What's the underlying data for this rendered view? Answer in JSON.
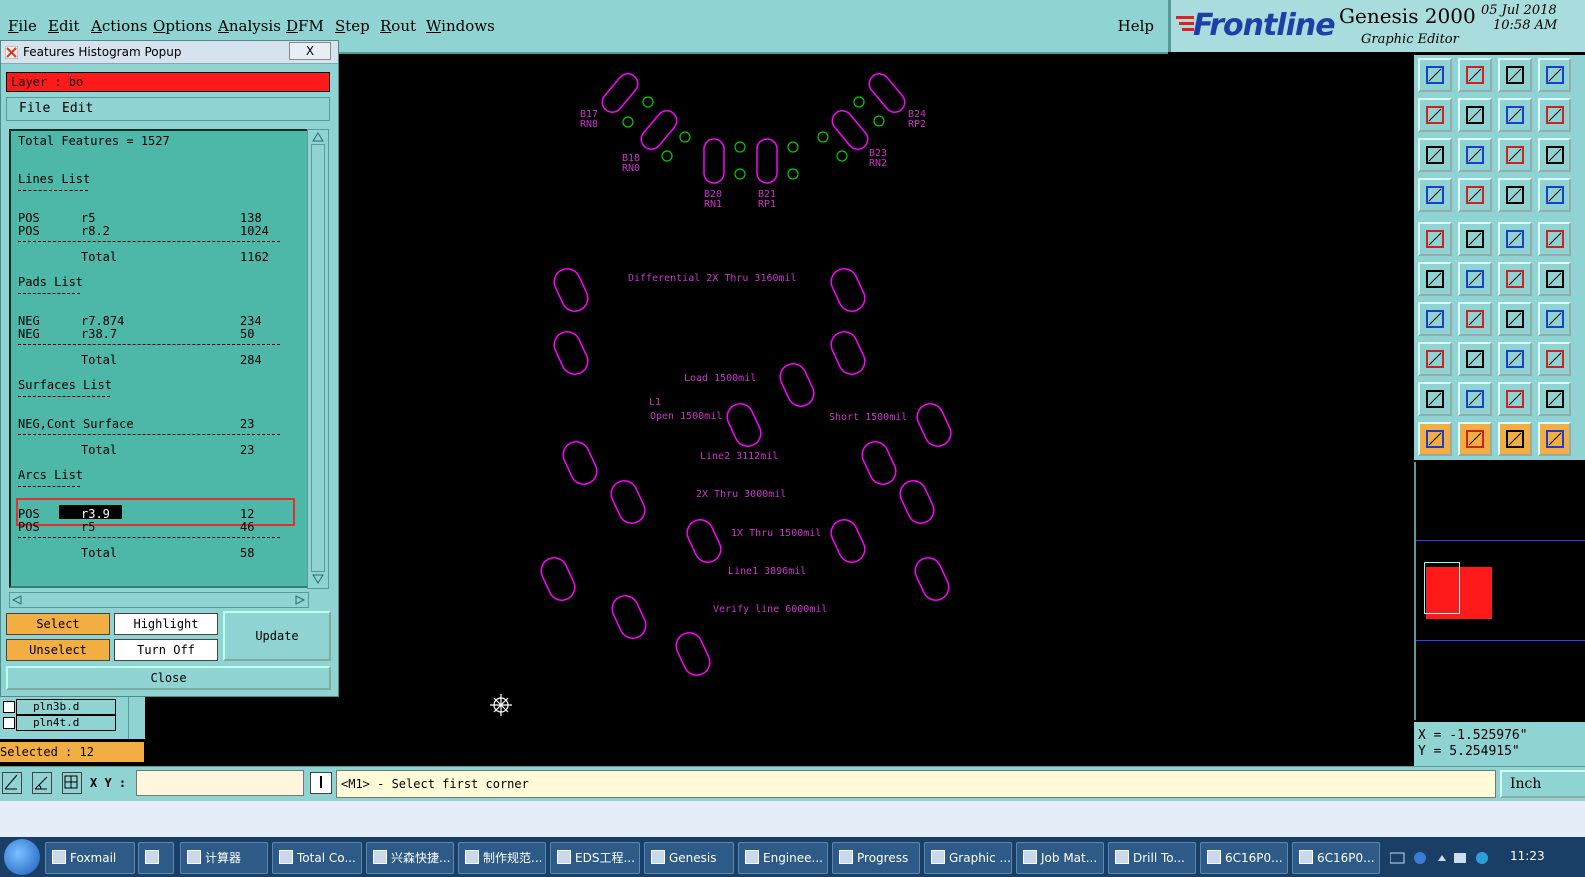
{
  "menubar": {
    "items": [
      "File",
      "Edit",
      "Actions",
      "Options",
      "Analysis",
      "DFM",
      "Step",
      "Rout",
      "Windows"
    ],
    "help": "Help"
  },
  "brand": {
    "logo": "Frontline",
    "product": "Genesis 2000",
    "subtitle": "Graphic Editor",
    "date": "05 Jul 2018",
    "time": "10:58 AM"
  },
  "popup": {
    "title": "Features Histogram Popup",
    "close_x": "X",
    "layer": "Layer :  bo",
    "menu": [
      "File",
      "Edit"
    ],
    "total_features": "Total Features = 1527",
    "lines_header": "Lines List",
    "lines": [
      {
        "pol": "POS",
        "sym": "r5",
        "count": "138"
      },
      {
        "pol": "POS",
        "sym": "r8.2",
        "count": "1024"
      }
    ],
    "lines_total": "1162",
    "pads_header": "Pads List",
    "pads": [
      {
        "pol": "NEG",
        "sym": "r7.874",
        "count": "234"
      },
      {
        "pol": "NEG",
        "sym": "r38.7",
        "count": "50"
      }
    ],
    "pads_total": "284",
    "surfaces_header": "Surfaces List",
    "surfaces": [
      {
        "pol": "NEG,Cont Surface",
        "sym": "",
        "count": "23"
      }
    ],
    "surfaces_total": "23",
    "arcs_header": "Arcs List",
    "arcs": [
      {
        "pol": "POS",
        "sym": "r3.9",
        "count": "12"
      },
      {
        "pol": "POS",
        "sym": "r5",
        "count": "46"
      }
    ],
    "arcs_total": "58",
    "total_label": "Total",
    "buttons": {
      "select": "Select",
      "highlight": "Highlight",
      "unselect": "Unselect",
      "turn_off": "Turn Off",
      "update": "Update",
      "close": "Close"
    }
  },
  "layers": [
    "pln3b.d",
    "pln4t.d"
  ],
  "selected": "Selected : 12",
  "cmdbar": {
    "xy_label": "X Y :",
    "xy_value": "",
    "message": "<M1> - Select first corner",
    "units": "Inch"
  },
  "coords": {
    "x": "X = -1.525976\"",
    "y": "Y = 5.254915\""
  },
  "canvas": {
    "labels": [
      "B17",
      "RN8",
      "B18",
      "RN0",
      "B20",
      "RN1",
      "B21",
      "RP1",
      "B23",
      "RN2",
      "B24",
      "RP2",
      "Differential  2X  Thru 3160mil",
      "Load  1500mil",
      "L1",
      "Open 1500mil",
      "Short 1500mil",
      "Line2 3112mil",
      "2X  Thru 3000mil",
      "1X  Thru 1500mil",
      "Line1 3896mil",
      "Verify line 6000mil"
    ],
    "colors": {
      "pad_outline": "#ff00ff",
      "pad_inner": "#3333ff",
      "via": "#00cc00",
      "text": "#cc33cc",
      "background": "#000000"
    }
  },
  "taskbar": {
    "items": [
      "Foxmail",
      "",
      "计算器",
      "Total Co...",
      "兴森快捷...",
      "制作规范...",
      "EDS工程...",
      "Genesis",
      "Enginee...",
      "Progress",
      "Graphic ...",
      "Job Mat...",
      "Drill To...",
      "6C16P0...",
      "6C16P0..."
    ],
    "clock": "11:23"
  },
  "colors": {
    "panel": "#8fd4d3",
    "listbox": "#4db8a8",
    "accent_orange": "#f3ae43",
    "layer_red": "#ff1a1a"
  }
}
